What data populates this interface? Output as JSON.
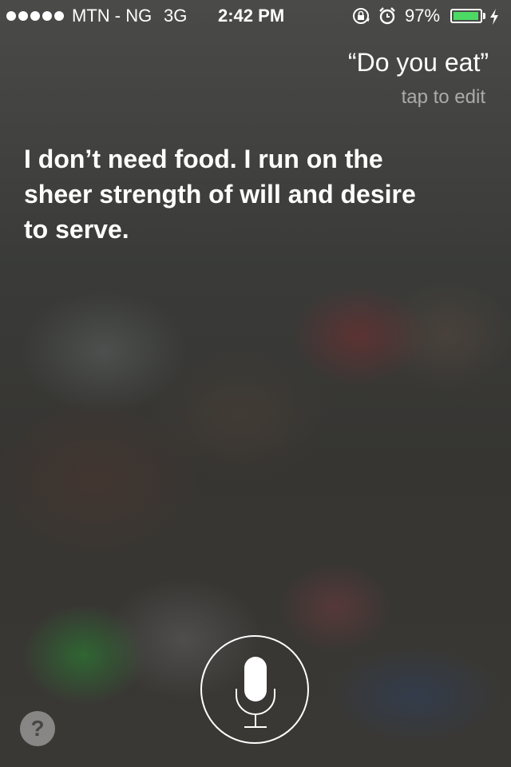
{
  "status_bar": {
    "carrier": "MTN - NG",
    "network": "3G",
    "time": "2:42 PM",
    "battery_percent": "97%",
    "battery_level": 0.97,
    "battery_color": "#4cd964",
    "signal_bars": 5,
    "icons": [
      "signal-dots-icon",
      "orientation-lock-icon",
      "alarm-icon",
      "battery-icon",
      "charging-bolt-icon"
    ]
  },
  "siri": {
    "query": "“Do you eat”",
    "tap_to_edit": "tap to edit",
    "response": "I don’t need food. I run on the sheer strength of will and desire to serve."
  },
  "controls": {
    "help_label": "?",
    "mic_icon": "microphone-icon"
  }
}
